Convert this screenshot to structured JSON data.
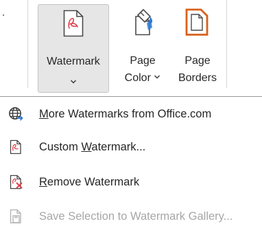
{
  "ribbon": {
    "watermark_button": {
      "label": "Watermark",
      "icon": "watermark-icon"
    },
    "page_color_button": {
      "label_line1": "Page",
      "label_line2": "Color",
      "icon": "page-color-icon"
    },
    "page_borders_button": {
      "label_line1": "Page",
      "label_line2": "Borders",
      "icon": "page-borders-icon"
    }
  },
  "menu": {
    "items": [
      {
        "pre": "",
        "mnemonic": "M",
        "post": "ore Watermarks from Office.com",
        "icon": "globe-icon",
        "enabled": true
      },
      {
        "pre": "Custom ",
        "mnemonic": "W",
        "post": "atermark...",
        "icon": "custom-watermark-icon",
        "enabled": true
      },
      {
        "pre": "",
        "mnemonic": "R",
        "post": "emove Watermark",
        "icon": "remove-watermark-icon",
        "enabled": true
      },
      {
        "pre": "Save Selection to Watermark Gallery...",
        "mnemonic": "",
        "post": "",
        "icon": "save-to-gallery-icon",
        "enabled": false
      }
    ]
  },
  "colors": {
    "accent_red": "#e0424c",
    "accent_orange": "#d8601a",
    "accent_blue": "#2b7cd3",
    "selected_bg": "#e6e6e6",
    "disabled_text": "#a6a6a6"
  }
}
